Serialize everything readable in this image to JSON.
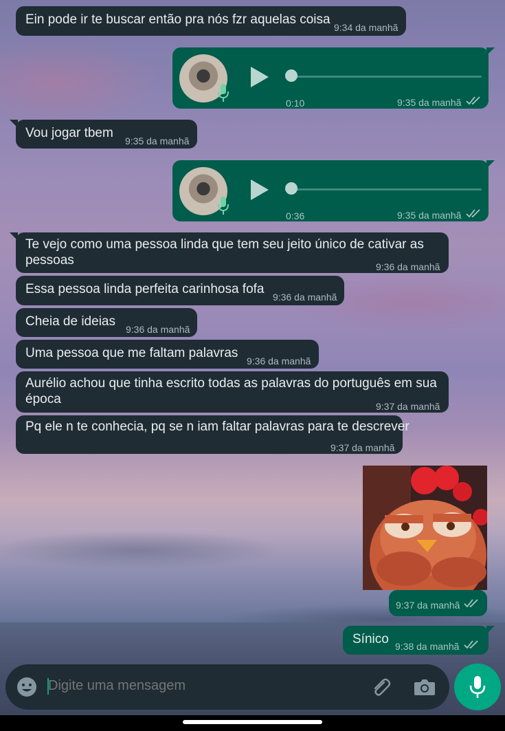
{
  "messages": [
    {
      "text": "Ein pode ir te buscar então pra nós fzr aquelas coisa",
      "time": "9:34 da manhã"
    },
    {
      "duration": "0:10",
      "time": "9:35 da manhã"
    },
    {
      "text": "Vou jogar tbem",
      "time": "9:35 da manhã"
    },
    {
      "duration": "0:36",
      "time": "9:35 da manhã"
    },
    {
      "text": "Te vejo como uma pessoa linda que tem seu jeito único de cativar as pessoas",
      "time": "9:36 da manhã"
    },
    {
      "text": "Essa pessoa linda perfeita carinhosa fofa",
      "time": "9:36 da manhã"
    },
    {
      "text": "Cheia de ideias",
      "time": "9:36 da manhã"
    },
    {
      "text": "Uma pessoa que me faltam palavras",
      "time": "9:36 da manhã"
    },
    {
      "text": "Aurélio achou que tinha escrito todas as palavras do português em sua época",
      "time": "9:37 da manhã"
    },
    {
      "text": "Pq ele n te conhecia, pq se n iam faltar palavras para te descrever",
      "time": "9:37 da manhã"
    },
    {
      "time": "9:37 da manhã"
    },
    {
      "text": "Sínico",
      "time": "9:38 da manhã"
    }
  ],
  "composer": {
    "placeholder": "Digite uma mensagem"
  },
  "icons": {
    "emoji": "emoji-icon",
    "attach": "paperclip-icon",
    "camera": "camera-icon",
    "mic": "microphone-icon",
    "read": "double-check-icon"
  },
  "colors": {
    "incoming_bubble": "#1f2c34",
    "outgoing_bubble": "#005c4b",
    "accent": "#00a884",
    "read_ticks": "#a7c7bf"
  }
}
